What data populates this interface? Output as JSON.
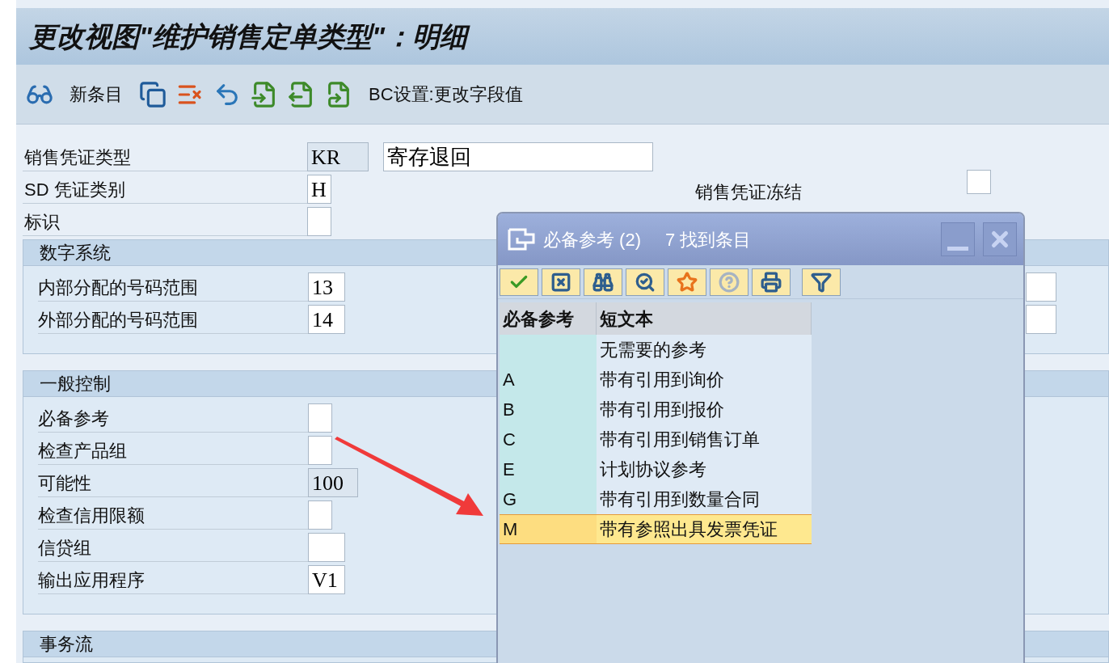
{
  "window": {
    "title": "更改视图\"维护销售定单类型\"：明细"
  },
  "toolbar": {
    "new_entry": "新条目",
    "bc_label": "BC设置:更改字段值"
  },
  "header_fields": [
    {
      "label": "销售凭证类型",
      "value": "KR",
      "disabled": true,
      "description": "寄存退回"
    },
    {
      "label": "SD 凭证类别",
      "value": "H",
      "disabled": false
    },
    {
      "label": "标识",
      "disabled": false
    }
  ],
  "block_field": {
    "label": "销售凭证冻结",
    "checked": false
  },
  "sections": [
    {
      "title": "数字系统",
      "fields": [
        {
          "label": "内部分配的号码范围",
          "value": "13",
          "disabled": false,
          "side_input": true
        },
        {
          "label": "外部分配的号码范围",
          "value": "14",
          "disabled": false,
          "side_input": true
        }
      ]
    },
    {
      "title": "一般控制",
      "fields": [
        {
          "label": "必备参考",
          "disabled": false,
          "side_input": false
        },
        {
          "label": "检查产品组",
          "disabled": false,
          "side_input": false
        },
        {
          "label": "可能性",
          "value": "100",
          "disabled": true,
          "side_input": false
        },
        {
          "label": "检查信用限额",
          "disabled": false,
          "side_input": false
        },
        {
          "label": "信贷组",
          "disabled": false,
          "side_input": false
        },
        {
          "label": "输出应用程序",
          "value": "V1",
          "disabled": false,
          "side_input": false
        }
      ]
    },
    {
      "title": "事务流"
    }
  ],
  "popup": {
    "title": "必备参考 (2)",
    "count": "7 找到条目",
    "columns": [
      "必备参考",
      "短文本"
    ],
    "rows": [
      {
        "text": "无需要的参考",
        "selected": false
      },
      {
        "code": "A",
        "text": "带有引用到询价",
        "selected": false
      },
      {
        "code": "B",
        "text": "带有引用到报价",
        "selected": false
      },
      {
        "code": "C",
        "text": "带有引用到销售订单",
        "selected": false
      },
      {
        "code": "E",
        "text": "计划协议参考",
        "selected": false
      },
      {
        "code": "G",
        "text": "带有引用到数量合同",
        "selected": false
      },
      {
        "code": "M",
        "text": "带有参照出具发票凭证",
        "selected": true
      }
    ]
  }
}
